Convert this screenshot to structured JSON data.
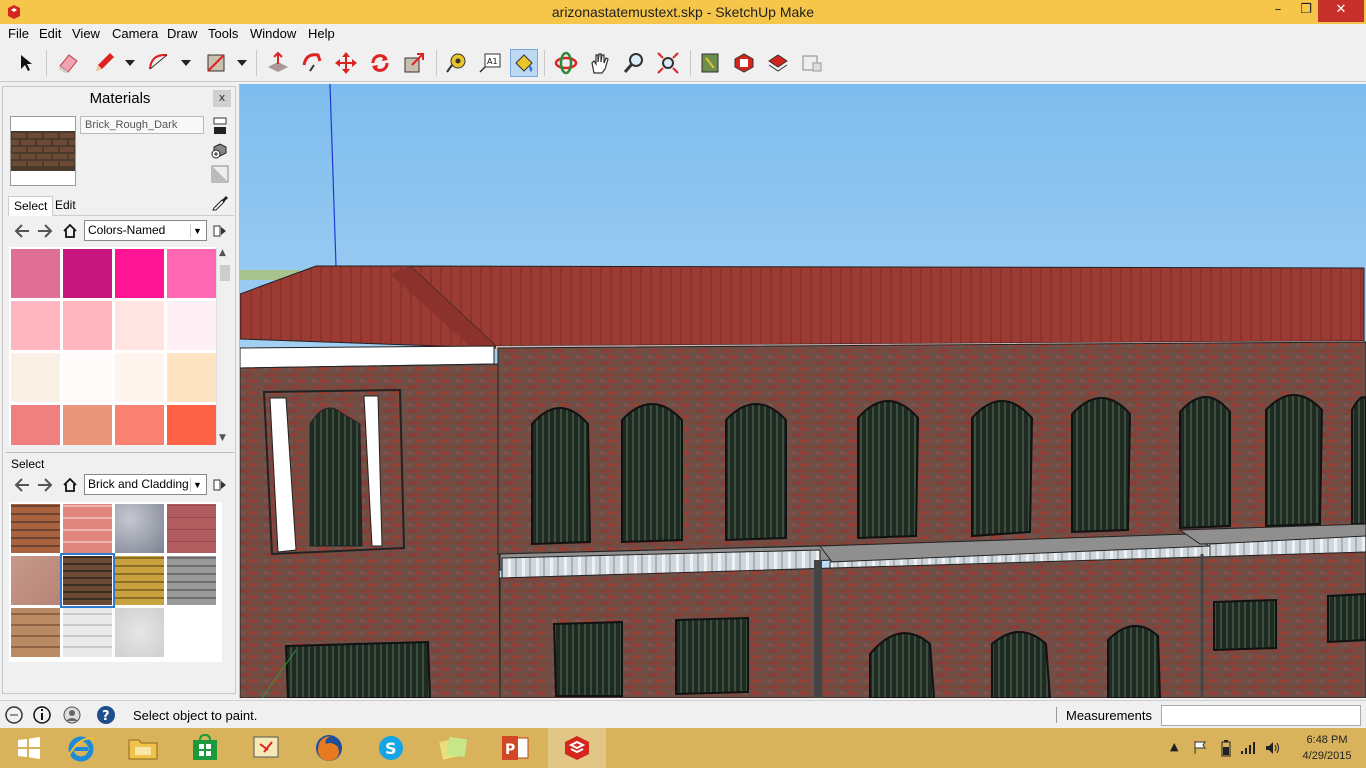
{
  "window": {
    "title": "arizonastatemustext.skp - SketchUp Make",
    "minimize": "–",
    "maximize": "❐",
    "close": "✕"
  },
  "menu": [
    "File",
    "Edit",
    "View",
    "Camera",
    "Draw",
    "Tools",
    "Window",
    "Help"
  ],
  "toolbar": {
    "active_tool": "paint-bucket",
    "tools": [
      "select",
      "eraser",
      "pencil",
      "arc",
      "rectangle",
      "push-pull",
      "follow-me",
      "move",
      "rotate",
      "scale",
      "tape-measure",
      "text",
      "paint-bucket",
      "orbit",
      "pan",
      "zoom",
      "zoom-extents",
      "3d-warehouse",
      "extension-warehouse",
      "share-model",
      "layout"
    ]
  },
  "materials": {
    "title": "Materials",
    "close_label": "x",
    "current_material": "Brick_Rough_Dark",
    "tabs": [
      "Select",
      "Edit"
    ],
    "active_tab": "Select",
    "top_collection": "Colors-Named",
    "top_swatches": [
      "#df6f94",
      "#c7177f",
      "#ff1493",
      "#ff69b4",
      "#ffb6c1",
      "#ffb6c1",
      "#ffe4e1",
      "#fff0f5",
      "#faf0e6",
      "#fffafa",
      "#fff5ee",
      "#ffe4c4",
      "#f08080",
      "#e9967a",
      "#fa8072",
      "#ff6347"
    ],
    "second_label": "Select",
    "bottom_collection": "Brick and Cladding",
    "bottom_swatches": [
      "brick-orange",
      "brick-pink-tile",
      "granite-blue",
      "brick-red-flat",
      "stone-pink",
      "brick-rough-dark",
      "brick-yellow",
      "stone-grey",
      "wood-siding",
      "siding-white",
      "stucco-white"
    ],
    "selected_swatch": 5
  },
  "status": {
    "message": "Select object to paint.",
    "measurements_label": "Measurements",
    "measurements_value": ""
  },
  "taskbar": {
    "apps": [
      "start",
      "internet-explorer",
      "file-explorer",
      "store",
      "snipping-tool",
      "firefox",
      "skype",
      "sticky-notes",
      "powerpoint",
      "sketchup"
    ],
    "active_app": "sketchup",
    "time": "6:48 PM",
    "date": "4/29/2015"
  },
  "colors": {
    "titlebar": "#f6c64a",
    "taskbar": "#d9b35c",
    "sky": "#8fc5ef",
    "roof": "#9b3b34",
    "brick": "#7e3f35",
    "accent": "#2e7ad1"
  }
}
